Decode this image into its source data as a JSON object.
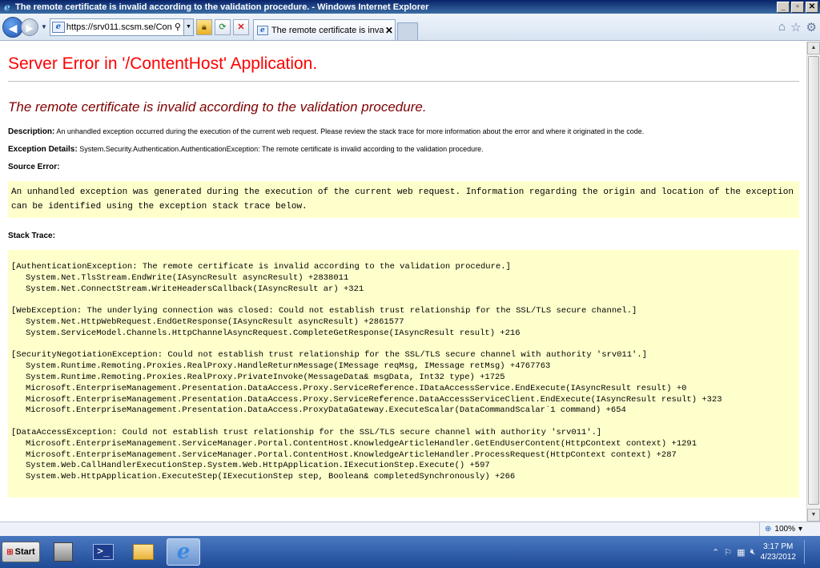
{
  "window": {
    "title": "The remote certificate is invalid according to the validation procedure. - Windows Internet Explorer",
    "buttons": {
      "minimize": "_",
      "maximize": "▫",
      "close": "✕"
    }
  },
  "nav": {
    "url": "https://srv011.scsm.se/Con",
    "tab_label": "The remote certificate is inva...",
    "tab_close": "✕"
  },
  "page": {
    "server_error_title": "Server Error in '/ContentHost' Application.",
    "error_title": "The remote certificate is invalid according to the validation procedure.",
    "description_label": "Description:",
    "description_text": "An unhandled exception occurred during the execution of the current web request. Please review the stack trace for more information about the error and where it originated in the code.",
    "exception_label": "Exception Details:",
    "exception_text": "System.Security.Authentication.AuthenticationException: The remote certificate is invalid according to the validation procedure.",
    "source_error_label": "Source Error:",
    "source_error_text": "An unhandled exception was generated during the execution of the current web request. Information regarding the origin and location of the exception can be identified using the exception stack trace below.",
    "stack_trace_label": "Stack Trace:",
    "stack_trace": [
      {
        "text": "[AuthenticationException: The remote certificate is invalid according to the validation procedure.]",
        "indent": false
      },
      {
        "text": "System.Net.TlsStream.EndWrite(IAsyncResult asyncResult) +2838011",
        "indent": true
      },
      {
        "text": "System.Net.ConnectStream.WriteHeadersCallback(IAsyncResult ar) +321",
        "indent": true
      },
      {
        "text": "",
        "indent": false
      },
      {
        "text": "[WebException: The underlying connection was closed: Could not establish trust relationship for the SSL/TLS secure channel.]",
        "indent": false
      },
      {
        "text": "System.Net.HttpWebRequest.EndGetResponse(IAsyncResult asyncResult) +2861577",
        "indent": true
      },
      {
        "text": "System.ServiceModel.Channels.HttpChannelAsyncRequest.CompleteGetResponse(IAsyncResult result) +216",
        "indent": true
      },
      {
        "text": "",
        "indent": false
      },
      {
        "text": "[SecurityNegotiationException: Could not establish trust relationship for the SSL/TLS secure channel with authority 'srv011'.]",
        "indent": false
      },
      {
        "text": "System.Runtime.Remoting.Proxies.RealProxy.HandleReturnMessage(IMessage reqMsg, IMessage retMsg) +4767763",
        "indent": true
      },
      {
        "text": "System.Runtime.Remoting.Proxies.RealProxy.PrivateInvoke(MessageData& msgData, Int32 type) +1725",
        "indent": true
      },
      {
        "text": "Microsoft.EnterpriseManagement.Presentation.DataAccess.Proxy.ServiceReference.IDataAccessService.EndExecute(IAsyncResult result) +0",
        "indent": true
      },
      {
        "text": "Microsoft.EnterpriseManagement.Presentation.DataAccess.Proxy.ServiceReference.DataAccessServiceClient.EndExecute(IAsyncResult result) +323",
        "indent": true
      },
      {
        "text": "Microsoft.EnterpriseManagement.Presentation.DataAccess.ProxyDataGateway.ExecuteScalar(DataCommandScalar`1 command) +654",
        "indent": true
      },
      {
        "text": "",
        "indent": false
      },
      {
        "text": "[DataAccessException: Could not establish trust relationship for the SSL/TLS secure channel with authority 'srv011'.]",
        "indent": false
      },
      {
        "text": "Microsoft.EnterpriseManagement.ServiceManager.Portal.ContentHost.KnowledgeArticleHandler.GetEndUserContent(HttpContext context) +1291",
        "indent": true
      },
      {
        "text": "Microsoft.EnterpriseManagement.ServiceManager.Portal.ContentHost.KnowledgeArticleHandler.ProcessRequest(HttpContext context) +287",
        "indent": true
      },
      {
        "text": "System.Web.CallHandlerExecutionStep.System.Web.HttpApplication.IExecutionStep.Execute() +597",
        "indent": true
      },
      {
        "text": "System.Web.HttpApplication.ExecuteStep(IExecutionStep step, Boolean& completedSynchronously) +266",
        "indent": true
      }
    ]
  },
  "status": {
    "zoom": "100%"
  },
  "taskbar": {
    "start_label": "Start",
    "clock_time": "3:17 PM",
    "clock_date": "4/23/2012"
  }
}
